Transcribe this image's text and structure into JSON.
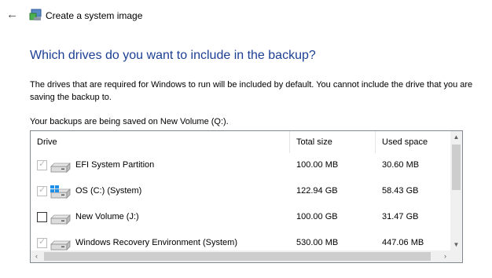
{
  "window": {
    "title": "Create a system image",
    "back_icon": "left-arrow-icon",
    "app_icon": "system-image-icon"
  },
  "main": {
    "heading": "Which drives do you want to include in the backup?",
    "description": "The drives that are required for Windows to run will be included by default. You cannot include the drive that you are saving the backup to.",
    "saving_location": "Your backups are being saved on New Volume (Q:)."
  },
  "table": {
    "columns": [
      "Drive",
      "Total size",
      "Used space"
    ],
    "rows": [
      {
        "name": "EFI System Partition",
        "total": "100.00 MB",
        "used": "30.60 MB",
        "checked": true,
        "disabled": true,
        "icon": "drive-icon"
      },
      {
        "name": "OS (C:) (System)",
        "total": "122.94 GB",
        "used": "58.43 GB",
        "checked": true,
        "disabled": true,
        "icon": "windows-drive-icon"
      },
      {
        "name": "New Volume (J:)",
        "total": "100.00 GB",
        "used": "31.47 GB",
        "checked": false,
        "disabled": false,
        "icon": "drive-icon"
      },
      {
        "name": "Windows Recovery Environment (System)",
        "total": "530.00 MB",
        "used": "447.06 MB",
        "checked": true,
        "disabled": true,
        "icon": "drive-icon"
      }
    ]
  },
  "colors": {
    "heading": "#1c3f94",
    "border": "#828790"
  }
}
